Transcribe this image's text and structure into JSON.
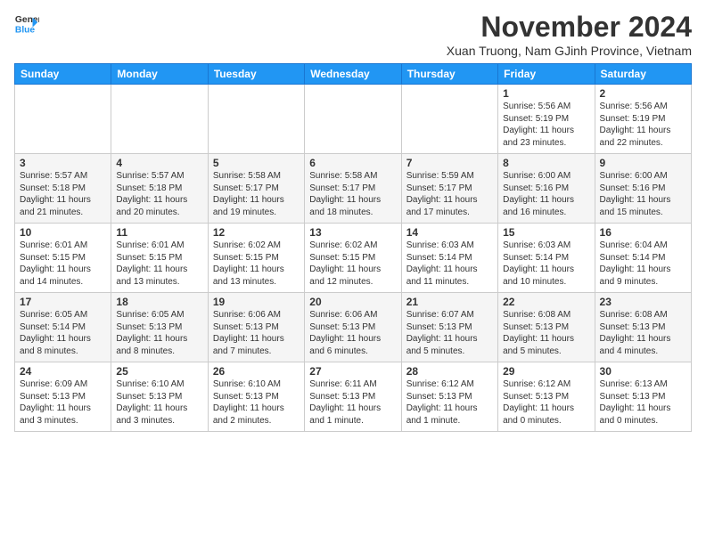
{
  "logo": {
    "line1": "General",
    "line2": "Blue"
  },
  "title": "November 2024",
  "subtitle": "Xuan Truong, Nam GJinh Province, Vietnam",
  "days_of_week": [
    "Sunday",
    "Monday",
    "Tuesday",
    "Wednesday",
    "Thursday",
    "Friday",
    "Saturday"
  ],
  "weeks": [
    [
      {
        "day": "",
        "info": ""
      },
      {
        "day": "",
        "info": ""
      },
      {
        "day": "",
        "info": ""
      },
      {
        "day": "",
        "info": ""
      },
      {
        "day": "",
        "info": ""
      },
      {
        "day": "1",
        "info": "Sunrise: 5:56 AM\nSunset: 5:19 PM\nDaylight: 11 hours\nand 23 minutes."
      },
      {
        "day": "2",
        "info": "Sunrise: 5:56 AM\nSunset: 5:19 PM\nDaylight: 11 hours\nand 22 minutes."
      }
    ],
    [
      {
        "day": "3",
        "info": "Sunrise: 5:57 AM\nSunset: 5:18 PM\nDaylight: 11 hours\nand 21 minutes."
      },
      {
        "day": "4",
        "info": "Sunrise: 5:57 AM\nSunset: 5:18 PM\nDaylight: 11 hours\nand 20 minutes."
      },
      {
        "day": "5",
        "info": "Sunrise: 5:58 AM\nSunset: 5:17 PM\nDaylight: 11 hours\nand 19 minutes."
      },
      {
        "day": "6",
        "info": "Sunrise: 5:58 AM\nSunset: 5:17 PM\nDaylight: 11 hours\nand 18 minutes."
      },
      {
        "day": "7",
        "info": "Sunrise: 5:59 AM\nSunset: 5:17 PM\nDaylight: 11 hours\nand 17 minutes."
      },
      {
        "day": "8",
        "info": "Sunrise: 6:00 AM\nSunset: 5:16 PM\nDaylight: 11 hours\nand 16 minutes."
      },
      {
        "day": "9",
        "info": "Sunrise: 6:00 AM\nSunset: 5:16 PM\nDaylight: 11 hours\nand 15 minutes."
      }
    ],
    [
      {
        "day": "10",
        "info": "Sunrise: 6:01 AM\nSunset: 5:15 PM\nDaylight: 11 hours\nand 14 minutes."
      },
      {
        "day": "11",
        "info": "Sunrise: 6:01 AM\nSunset: 5:15 PM\nDaylight: 11 hours\nand 13 minutes."
      },
      {
        "day": "12",
        "info": "Sunrise: 6:02 AM\nSunset: 5:15 PM\nDaylight: 11 hours\nand 13 minutes."
      },
      {
        "day": "13",
        "info": "Sunrise: 6:02 AM\nSunset: 5:15 PM\nDaylight: 11 hours\nand 12 minutes."
      },
      {
        "day": "14",
        "info": "Sunrise: 6:03 AM\nSunset: 5:14 PM\nDaylight: 11 hours\nand 11 minutes."
      },
      {
        "day": "15",
        "info": "Sunrise: 6:03 AM\nSunset: 5:14 PM\nDaylight: 11 hours\nand 10 minutes."
      },
      {
        "day": "16",
        "info": "Sunrise: 6:04 AM\nSunset: 5:14 PM\nDaylight: 11 hours\nand 9 minutes."
      }
    ],
    [
      {
        "day": "17",
        "info": "Sunrise: 6:05 AM\nSunset: 5:14 PM\nDaylight: 11 hours\nand 8 minutes."
      },
      {
        "day": "18",
        "info": "Sunrise: 6:05 AM\nSunset: 5:13 PM\nDaylight: 11 hours\nand 8 minutes."
      },
      {
        "day": "19",
        "info": "Sunrise: 6:06 AM\nSunset: 5:13 PM\nDaylight: 11 hours\nand 7 minutes."
      },
      {
        "day": "20",
        "info": "Sunrise: 6:06 AM\nSunset: 5:13 PM\nDaylight: 11 hours\nand 6 minutes."
      },
      {
        "day": "21",
        "info": "Sunrise: 6:07 AM\nSunset: 5:13 PM\nDaylight: 11 hours\nand 5 minutes."
      },
      {
        "day": "22",
        "info": "Sunrise: 6:08 AM\nSunset: 5:13 PM\nDaylight: 11 hours\nand 5 minutes."
      },
      {
        "day": "23",
        "info": "Sunrise: 6:08 AM\nSunset: 5:13 PM\nDaylight: 11 hours\nand 4 minutes."
      }
    ],
    [
      {
        "day": "24",
        "info": "Sunrise: 6:09 AM\nSunset: 5:13 PM\nDaylight: 11 hours\nand 3 minutes."
      },
      {
        "day": "25",
        "info": "Sunrise: 6:10 AM\nSunset: 5:13 PM\nDaylight: 11 hours\nand 3 minutes."
      },
      {
        "day": "26",
        "info": "Sunrise: 6:10 AM\nSunset: 5:13 PM\nDaylight: 11 hours\nand 2 minutes."
      },
      {
        "day": "27",
        "info": "Sunrise: 6:11 AM\nSunset: 5:13 PM\nDaylight: 11 hours\nand 1 minute."
      },
      {
        "day": "28",
        "info": "Sunrise: 6:12 AM\nSunset: 5:13 PM\nDaylight: 11 hours\nand 1 minute."
      },
      {
        "day": "29",
        "info": "Sunrise: 6:12 AM\nSunset: 5:13 PM\nDaylight: 11 hours\nand 0 minutes."
      },
      {
        "day": "30",
        "info": "Sunrise: 6:13 AM\nSunset: 5:13 PM\nDaylight: 11 hours\nand 0 minutes."
      }
    ]
  ]
}
